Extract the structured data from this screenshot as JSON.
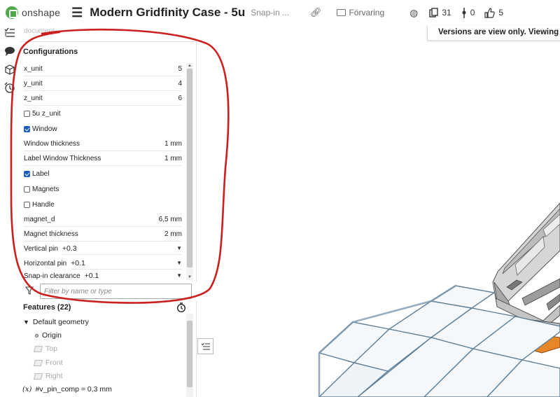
{
  "topbar": {
    "logo_text": "onshape",
    "title": "Modern Gridfinity Case - 5u",
    "subtitle": "Snap-in ...",
    "folder": "Förvaring",
    "copies": "31",
    "links": "0",
    "likes": "5"
  },
  "banner": "Versions are view only. Viewing Snap",
  "breadcrumb": "document",
  "config": {
    "title": "Configurations",
    "fields": [
      {
        "label": "x_unit",
        "value": "5"
      },
      {
        "label": "y_unit",
        "value": "4"
      },
      {
        "label": "z_unit",
        "value": "6"
      }
    ],
    "cb_5u": "5u z_unit",
    "cb_window": "Window",
    "window_thickness": {
      "label": "Window thickness",
      "value": "1 mm"
    },
    "label_window_thickness": {
      "label": "Label Window Thickness",
      "value": "1 mm"
    },
    "cb_label": "Label",
    "cb_magnets": "Magnets",
    "cb_handle": "Handle",
    "magnet_d": {
      "label": "magnet_d",
      "value": "6,5 mm"
    },
    "magnet_thickness": {
      "label": "Magnet thickness",
      "value": "2 mm"
    },
    "vertical_pin": {
      "label": "Vertical pin",
      "value": "+0.3"
    },
    "horizontal_pin": {
      "label": "Horizontal pin",
      "value": "+0.1"
    },
    "snap_clearance": {
      "label": "Snap-in clearance",
      "value": "+0.1"
    }
  },
  "filter": {
    "placeholder": "Filter by name or type"
  },
  "features": {
    "header": "Features (22)",
    "group": "Default geometry",
    "origin": "Origin",
    "top": "Top",
    "front": "Front",
    "right": "Right",
    "variable": "#v_pin_comp = 0,3 mm",
    "variable_prefix": "(x)"
  },
  "colors": {
    "accent": "#1f5fbf",
    "annotation": "#cc1f1f",
    "label_part": "#e8862a",
    "model_blue": "#8aa8bf",
    "model_grey": "#9a9a9a"
  }
}
